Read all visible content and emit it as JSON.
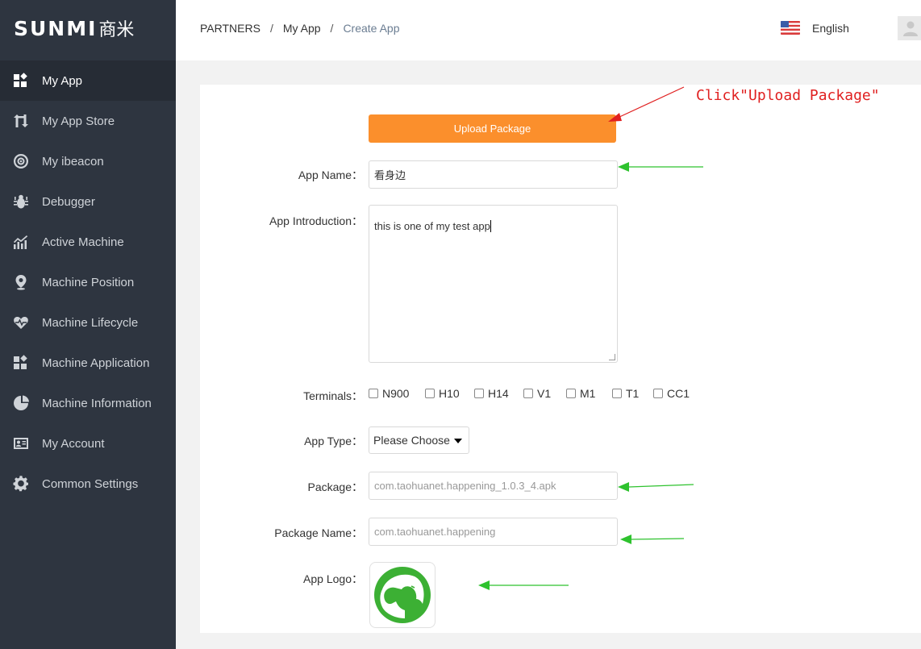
{
  "brand": {
    "logo_en": "SUNMI",
    "logo_cn": "商米"
  },
  "sidebar": {
    "items": [
      {
        "label": "My App",
        "icon": "apps-grid-icon",
        "active": true
      },
      {
        "label": "My App Store",
        "icon": "store-arrows-icon"
      },
      {
        "label": "My ibeacon",
        "icon": "beacon-icon"
      },
      {
        "label": "Debugger",
        "icon": "bug-icon"
      },
      {
        "label": "Active Machine",
        "icon": "trend-chart-icon"
      },
      {
        "label": "Machine Position",
        "icon": "location-pin-icon"
      },
      {
        "label": "Machine Lifecycle",
        "icon": "heartbeat-icon"
      },
      {
        "label": "Machine Application",
        "icon": "apps-grid-icon"
      },
      {
        "label": "Machine Information",
        "icon": "pie-chart-icon"
      },
      {
        "label": "My Account",
        "icon": "id-card-icon"
      },
      {
        "label": "Common Settings",
        "icon": "gear-icon"
      }
    ]
  },
  "header": {
    "breadcrumb": [
      "PARTNERS",
      "My App",
      "Create App"
    ],
    "separator": "/",
    "language": "English"
  },
  "form": {
    "upload_button": "Upload Package",
    "app_name_label": "App Name：",
    "app_name_value": "看身边",
    "intro_label": "App Introduction：",
    "intro_value": "this is one of my test app",
    "terminals_label": "Terminals：",
    "terminals": [
      "N900",
      "H10",
      "H14",
      "V1",
      "M1",
      "T1",
      "CC1"
    ],
    "app_type_label": "App Type：",
    "app_type_value": "Please Choose",
    "package_label": "Package：",
    "package_value": "com.taohuanet.happening_1.0.3_4.apk",
    "package_name_label": "Package Name：",
    "package_name_value": "com.taohuanet.happening",
    "app_logo_label": "App Logo："
  },
  "annotation": {
    "text": "Click\"Upload Package\""
  },
  "colors": {
    "sidebar": "#2e3540",
    "accent": "#fb8f2c",
    "logo_green": "#3cb034",
    "arrow_red": "#e02020",
    "arrow_green": "#2ec22e"
  }
}
